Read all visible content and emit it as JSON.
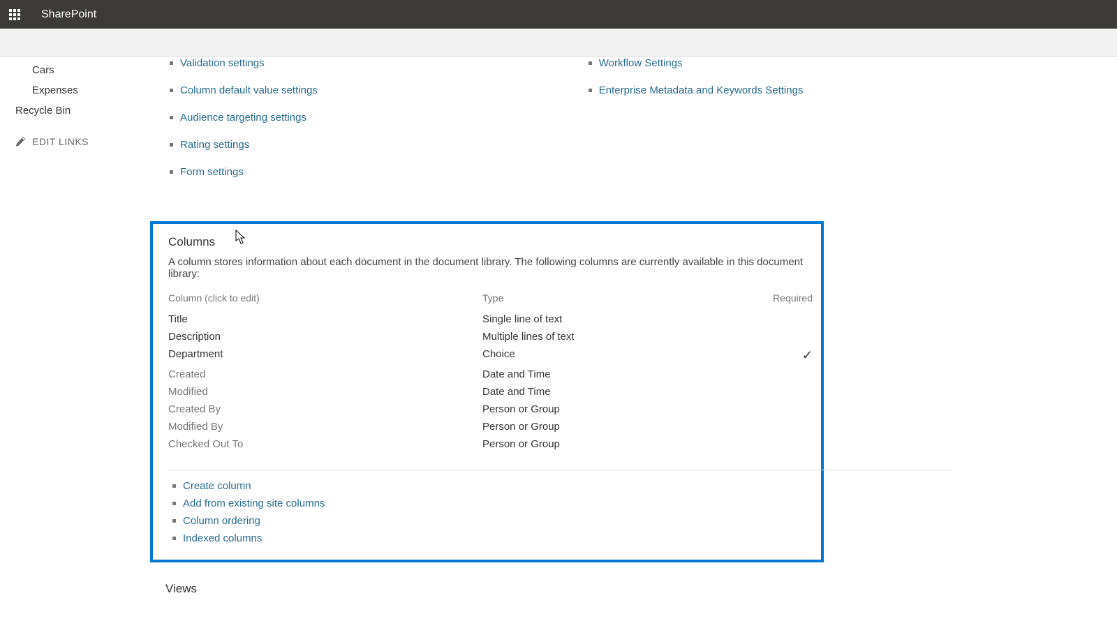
{
  "brand": "SharePoint",
  "sidebar": {
    "items": [
      {
        "label": "Cars",
        "indent": false
      },
      {
        "label": "Expenses",
        "indent": false
      }
    ],
    "recycle": "Recycle Bin",
    "edit": "EDIT LINKS"
  },
  "settings_links_left": [
    "Validation settings",
    "Column default value settings",
    "Audience targeting settings",
    "Rating settings",
    "Form settings"
  ],
  "settings_links_right": [
    "Workflow Settings",
    "Enterprise Metadata and Keywords Settings"
  ],
  "columns_section": {
    "title": "Columns",
    "desc": "A column stores information about each document in the document library. The following columns are currently available in this document library:",
    "head": {
      "c1": "Column (click to edit)",
      "c2": "Type",
      "c3": "Required"
    },
    "rows": [
      {
        "name": "Title",
        "type": "Single line of text",
        "required": false,
        "muted": false
      },
      {
        "name": "Description",
        "type": "Multiple lines of text",
        "required": false,
        "muted": false
      },
      {
        "name": "Department",
        "type": "Choice",
        "required": true,
        "muted": false
      },
      {
        "name": "Created",
        "type": "Date and Time",
        "required": false,
        "muted": true
      },
      {
        "name": "Modified",
        "type": "Date and Time",
        "required": false,
        "muted": true
      },
      {
        "name": "Created By",
        "type": "Person or Group",
        "required": false,
        "muted": true
      },
      {
        "name": "Modified By",
        "type": "Person or Group",
        "required": false,
        "muted": true
      },
      {
        "name": "Checked Out To",
        "type": "Person or Group",
        "required": false,
        "muted": true
      }
    ],
    "actions": [
      "Create column",
      "Add from existing site columns",
      "Column ordering",
      "Indexed columns"
    ]
  },
  "views_title": "Views",
  "check_glyph": "✓"
}
